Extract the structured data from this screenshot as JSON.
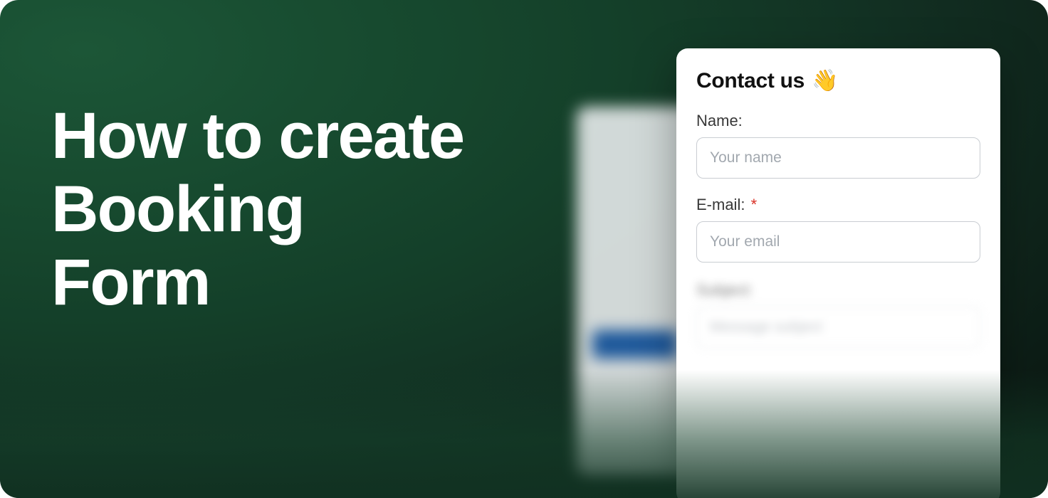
{
  "headline": {
    "line1": "How to create",
    "line2": "Booking",
    "line3": "Form"
  },
  "card": {
    "title": "Contact us",
    "wave": "👋",
    "fields": {
      "name": {
        "label": "Name:",
        "placeholder": "Your name"
      },
      "email": {
        "label": "E-mail:",
        "required_mark": "*",
        "placeholder": "Your email"
      },
      "subject": {
        "label": "Subject:",
        "placeholder": "Message subject"
      }
    }
  }
}
